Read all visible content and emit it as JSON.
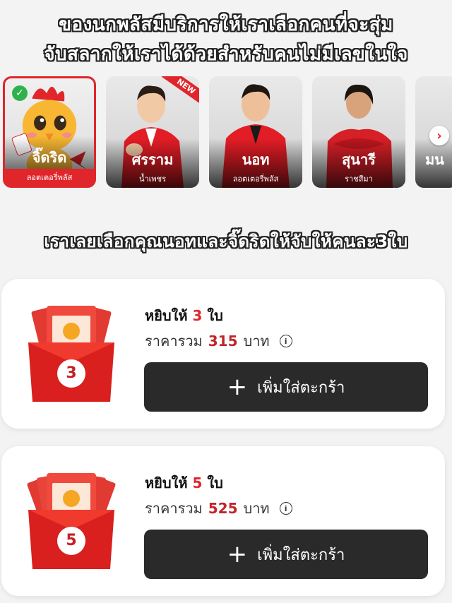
{
  "captions": {
    "line1": "ของนกพลัสมีบริการให้เราเลือกคนที่จะสุ่ม",
    "line2": "จับสลากให้เราได้ด้วยสำหรับคนไม่มีเลขในใจ",
    "line3": "เราเลยเลือกคุณนอทและจิ๊ดริดให้จับให้คนละ3ใบ"
  },
  "presenters": [
    {
      "name": "จิ๊ดริด",
      "subtitle": "ลอตเตอรี่พลัส",
      "selected": true
    },
    {
      "name": "ศรราม",
      "subtitle": "น้ำเพชร",
      "badge": "NEW"
    },
    {
      "name": "นอท",
      "subtitle": "ลอตเตอรี่พลัส"
    },
    {
      "name": "สุนารี",
      "subtitle": "ราชสีมา"
    },
    {
      "name": "มน",
      "subtitle": ""
    }
  ],
  "offers": [
    {
      "title_prefix": "หยิบให้",
      "count": "3",
      "unit": "ใบ",
      "price_label": "ราคารวม",
      "price": "315",
      "currency": "บาท",
      "button_label": "เพิ่มใส่ตะกร้า",
      "packet_number": "3"
    },
    {
      "title_prefix": "หยิบให้",
      "count": "5",
      "unit": "ใบ",
      "price_label": "ราคารวม",
      "price": "525",
      "currency": "บาท",
      "button_label": "เพิ่มใส่ตะกร้า",
      "packet_number": "5"
    }
  ],
  "icons": {
    "selected_check": "check-circle-icon",
    "carousel_next": "chevron-right-icon",
    "info": "info-icon",
    "add": "plus-icon"
  },
  "colors": {
    "accent_red": "#e0262b",
    "button_dark": "#2a2a2a",
    "check_green": "#2fb14b"
  }
}
